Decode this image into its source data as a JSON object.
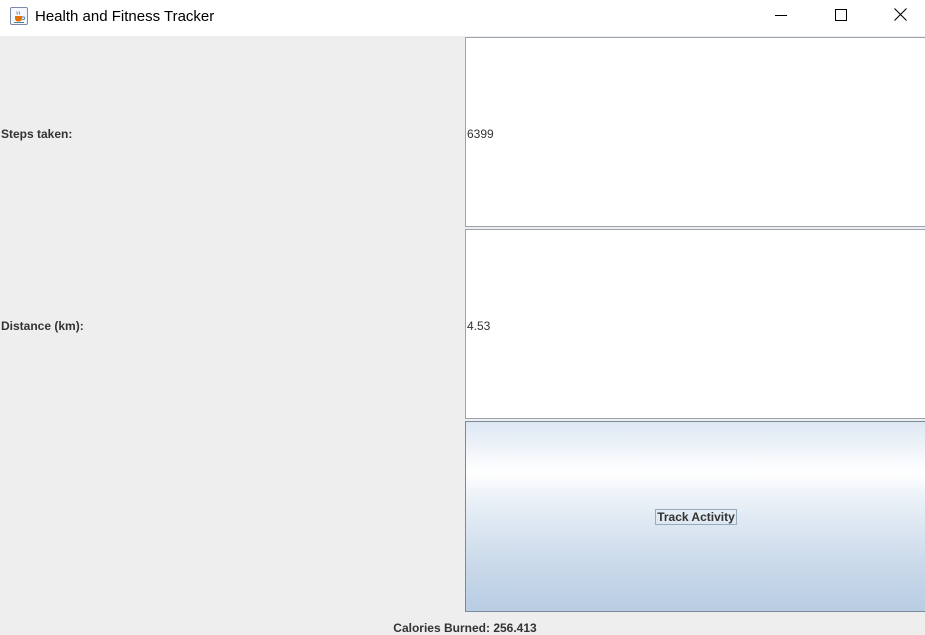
{
  "window": {
    "title": "Health and Fitness Tracker",
    "app_icon": "java-cup-icon",
    "controls": {
      "minimize_icon": "minimize-icon",
      "maximize_icon": "maximize-icon",
      "close_icon": "close-icon"
    }
  },
  "form": {
    "steps_label": "Steps taken:",
    "steps_value": "6399",
    "distance_label": "Distance (km):",
    "distance_value": "4.53",
    "track_button_label": "Track Activity"
  },
  "result": {
    "calories_text": "Calories Burned: 256.413"
  }
}
